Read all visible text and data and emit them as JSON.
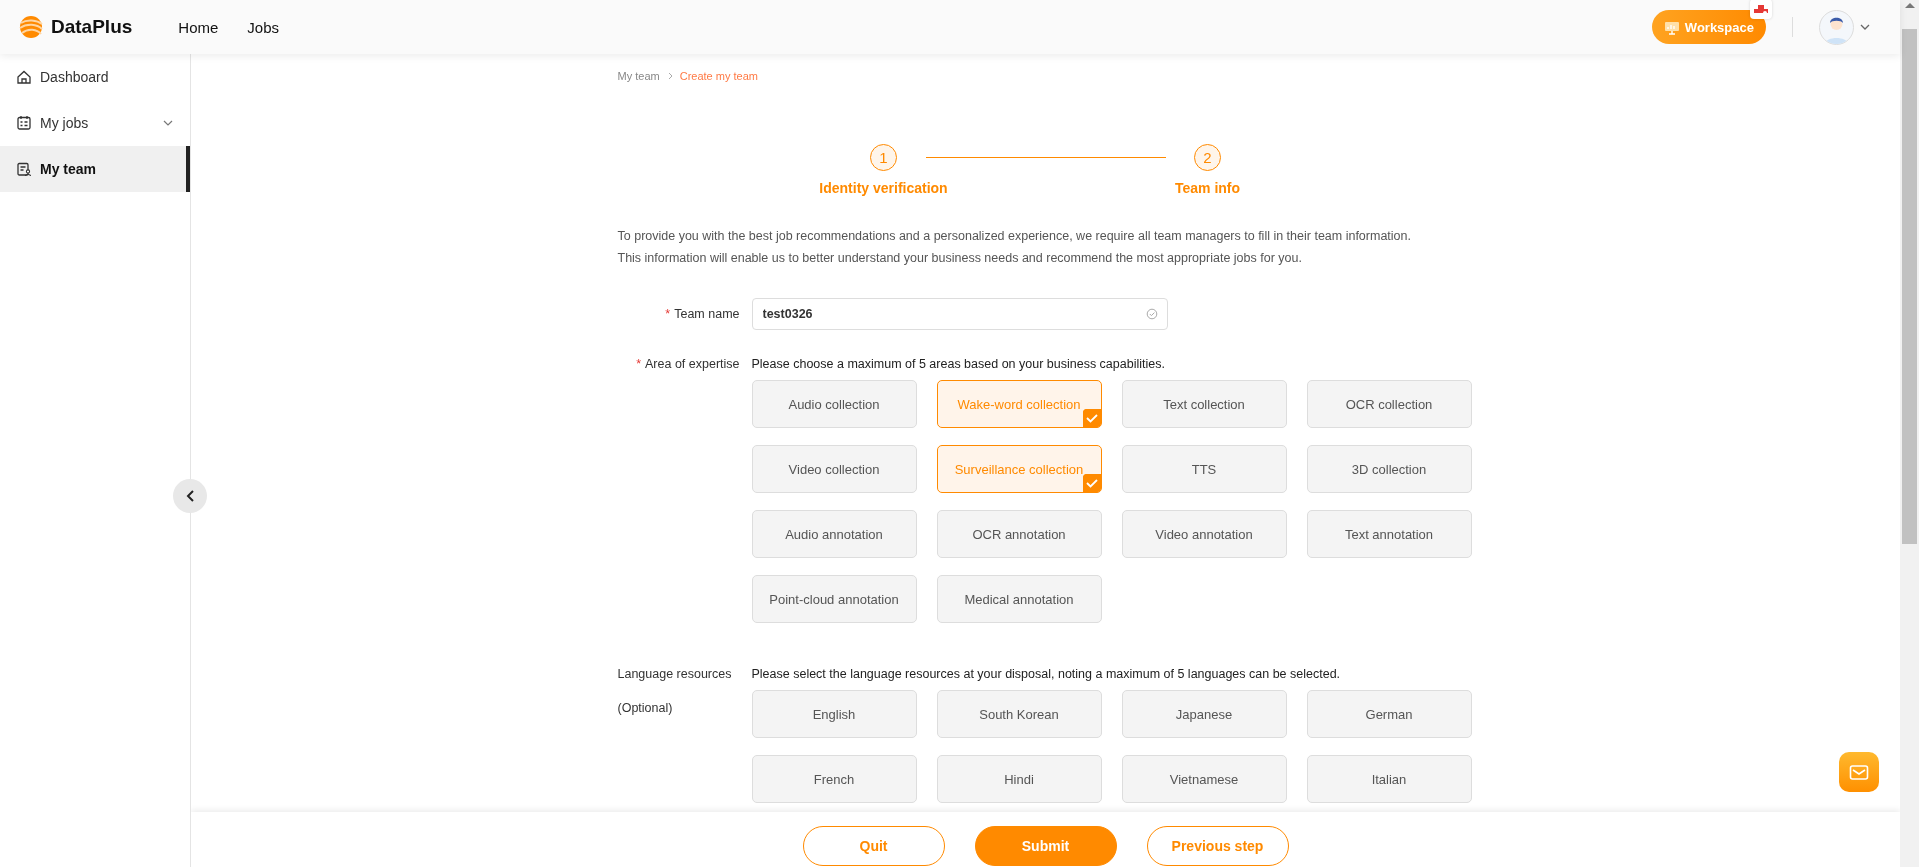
{
  "header": {
    "logo": "DataPlus",
    "nav": [
      {
        "label": "Home"
      },
      {
        "label": "Jobs"
      }
    ],
    "workspace_button": "Workspace"
  },
  "sidebar": {
    "items": [
      {
        "label": "Dashboard",
        "expandable": false,
        "selected": false
      },
      {
        "label": "My jobs",
        "expandable": true,
        "selected": false
      },
      {
        "label": "My team",
        "expandable": false,
        "selected": true
      }
    ]
  },
  "breadcrumb": [
    {
      "label": "My team",
      "current": false
    },
    {
      "label": "Create my team",
      "current": true
    }
  ],
  "steps": [
    {
      "number": "1",
      "label": "Identity verification"
    },
    {
      "number": "2",
      "label": "Team info"
    }
  ],
  "intro": [
    "To provide you with the best job recommendations and a personalized experience, we require all team managers to fill in their team information.",
    "This information will enable us to better understand your business needs and recommend the most appropriate jobs for you."
  ],
  "form": {
    "team_name": {
      "required_mark": "*",
      "label": "Team name",
      "value": "test0326"
    },
    "expertise": {
      "required_mark": "*",
      "label": "Area of expertise",
      "hint": "Please choose a maximum of 5 areas based on your business capabilities.",
      "options": [
        {
          "label": "Audio collection",
          "selected": false
        },
        {
          "label": "Wake-word collection",
          "selected": true
        },
        {
          "label": "Text collection",
          "selected": false
        },
        {
          "label": "OCR collection",
          "selected": false
        },
        {
          "label": "Video collection",
          "selected": false
        },
        {
          "label": "Surveillance collection",
          "selected": true
        },
        {
          "label": "TTS",
          "selected": false
        },
        {
          "label": "3D collection",
          "selected": false
        },
        {
          "label": "Audio annotation",
          "selected": false
        },
        {
          "label": "OCR annotation",
          "selected": false
        },
        {
          "label": "Video annotation",
          "selected": false
        },
        {
          "label": "Text annotation",
          "selected": false
        },
        {
          "label": "Point-cloud annotation",
          "selected": false
        },
        {
          "label": "Medical annotation",
          "selected": false
        }
      ]
    },
    "languages": {
      "label": "Language resources",
      "sublabel": "(Optional)",
      "hint": "Please select the language resources at your disposal, noting a maximum of 5 languages can be selected.",
      "options": [
        {
          "label": "English",
          "selected": false
        },
        {
          "label": "South Korean",
          "selected": false
        },
        {
          "label": "Japanese",
          "selected": false
        },
        {
          "label": "German",
          "selected": false
        },
        {
          "label": "French",
          "selected": false
        },
        {
          "label": "Hindi",
          "selected": false
        },
        {
          "label": "Vietnamese",
          "selected": false
        },
        {
          "label": "Italian",
          "selected": false
        }
      ]
    }
  },
  "buttons": [
    {
      "label": "Quit",
      "kind": "outline"
    },
    {
      "label": "Submit",
      "kind": "primary"
    },
    {
      "label": "Previous step",
      "kind": "outline"
    }
  ]
}
